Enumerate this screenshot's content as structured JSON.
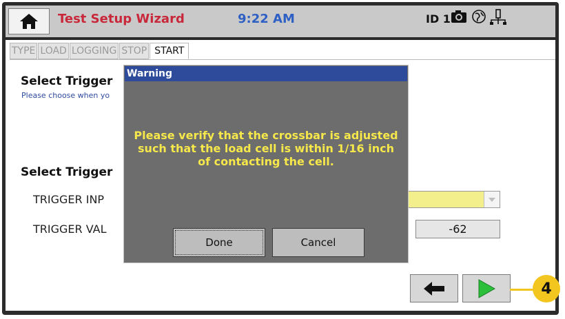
{
  "header": {
    "title": "Test Setup Wizard",
    "time": "9:22 AM",
    "id_label": "ID 1",
    "icons": [
      "home-icon",
      "camera-icon",
      "globe-icon",
      "network-icon"
    ]
  },
  "tabs": [
    {
      "label": "TYPE",
      "active": false
    },
    {
      "label": "LOAD",
      "active": false
    },
    {
      "label": "LOGGING",
      "active": false
    },
    {
      "label": "STOP",
      "active": false
    },
    {
      "label": "START",
      "active": true
    }
  ],
  "form": {
    "section1_heading": "Select Trigger",
    "section1_sub": "Please choose when yo",
    "section2_heading": "Select Trigger",
    "row1_label": "TRIGGER INP",
    "row1_value": "",
    "row2_label": "TRIGGER VAL",
    "row2_value": "-62"
  },
  "nav": {
    "back_icon": "arrow-left-icon",
    "next_icon": "play-right-icon"
  },
  "callout": {
    "label": "4",
    "color": "#f2c61e"
  },
  "dialog": {
    "title": "Warning",
    "message": "Please verify that the crossbar is adjusted such that the load cell is within 1/16 inch of contacting the cell.",
    "done_label": "Done",
    "cancel_label": "Cancel"
  },
  "colors": {
    "title": "#c8283a",
    "time": "#2e5fc4",
    "dialog_title_bar": "#2d4b9a",
    "dialog_text": "#f6e84a",
    "select_fill": "#f3ef8c",
    "next_arrow": "#2bbf3a"
  }
}
